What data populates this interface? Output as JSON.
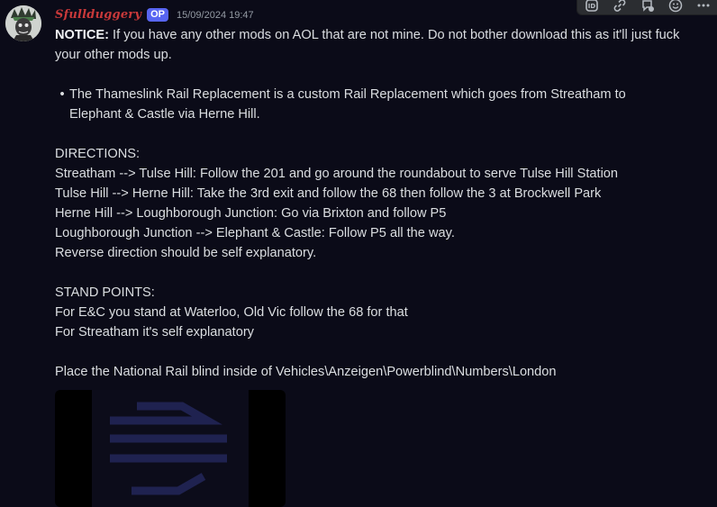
{
  "message": {
    "username": "Sfullduggery",
    "badge": "OP",
    "timestamp": "15/09/2024 19:47",
    "notice_label": "NOTICE:",
    "notice_text": " If you have any other mods on AOL that are not mine. Do not bother download this as it'll just fuck your other mods up.",
    "bullet_text": "The Thameslink Rail Replacement is a custom Rail Replacement which goes from Streatham to Elephant & Castle via Herne Hill.",
    "directions": {
      "heading": "DIRECTIONS:",
      "lines": [
        "Streatham --> Tulse Hill: Follow the 201 and go around the roundabout to serve Tulse Hill Station",
        "Tulse Hill --> Herne Hill: Take the 3rd exit and follow the 68 then follow the 3 at Brockwell Park",
        "Herne Hill --> Loughborough Junction: Go via Brixton and follow P5",
        "Loughborough Junction --> Elephant & Castle: Follow P5 all the way.",
        "Reverse direction should be self explanatory."
      ]
    },
    "stand_points": {
      "heading": "STAND POINTS:",
      "lines": [
        "For E&C you stand at Waterloo, Old Vic follow the 68 for that",
        "For Streatham it's self explanatory"
      ]
    },
    "blind_instruction": "Place the National Rail blind inside of Vehicles\\Anzeigen\\Powerblind\\Numbers\\London"
  },
  "toolbar": {
    "icons": [
      "app-icon",
      "link-icon",
      "thread-icon",
      "emoji-icon",
      "more-icon"
    ]
  },
  "colors": {
    "background": "#0b0b18",
    "username": "#c9393a",
    "badge": "#5865f2",
    "timestamp": "#949ba4",
    "text": "#dbdee1"
  }
}
